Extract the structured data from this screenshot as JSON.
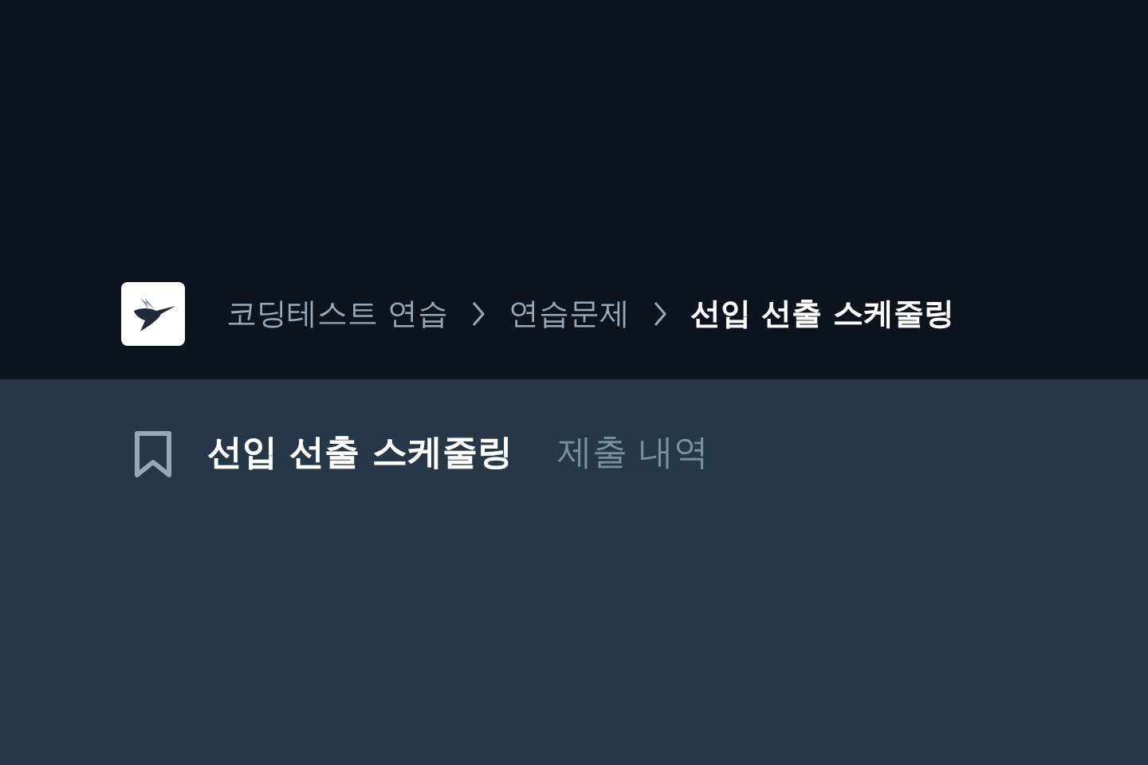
{
  "breadcrumb": [
    {
      "label": "코딩테스트 연습",
      "current": false
    },
    {
      "label": "연습문제",
      "current": false
    },
    {
      "label": "선입 선출 스케줄링",
      "current": true
    }
  ],
  "tabs": [
    {
      "label": "선입 선출 스케줄링",
      "selected": true
    },
    {
      "label": "제출 내역",
      "selected": false
    }
  ]
}
